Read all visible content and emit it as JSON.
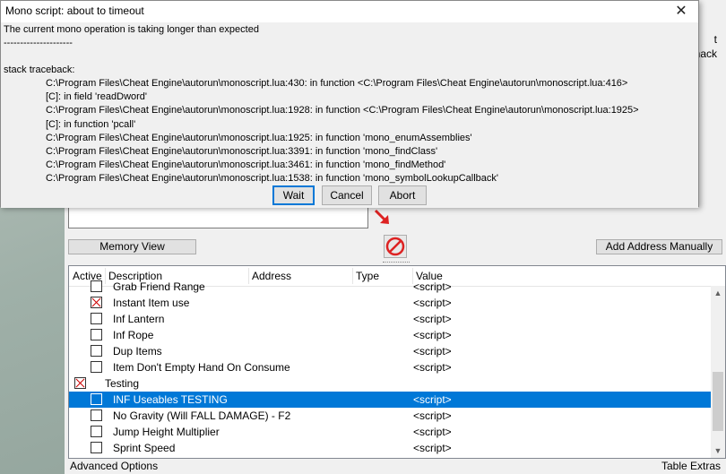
{
  "dialog": {
    "title": "Mono script: about to timeout",
    "close_glyph": "✕",
    "message": "The current mono operation is taking longer than expected",
    "separator": "---------------------",
    "traceback_header": "stack traceback:",
    "traceback": [
      "C:\\Program Files\\Cheat Engine\\autorun\\monoscript.lua:430: in function <C:\\Program Files\\Cheat Engine\\autorun\\monoscript.lua:416>",
      "[C]: in field 'readDword'",
      "C:\\Program Files\\Cheat Engine\\autorun\\monoscript.lua:1928: in function <C:\\Program Files\\Cheat Engine\\autorun\\monoscript.lua:1925>",
      "[C]: in function 'pcall'",
      "C:\\Program Files\\Cheat Engine\\autorun\\monoscript.lua:1925: in function 'mono_enumAssemblies'",
      "C:\\Program Files\\Cheat Engine\\autorun\\monoscript.lua:3391: in function 'mono_findClass'",
      "C:\\Program Files\\Cheat Engine\\autorun\\monoscript.lua:3461: in function 'mono_findMethod'",
      "C:\\Program Files\\Cheat Engine\\autorun\\monoscript.lua:1538: in function 'mono_symbolLookupCallback'"
    ],
    "buttons": {
      "wait": "Wait",
      "cancel": "Cancel",
      "abort": "Abort"
    }
  },
  "main": {
    "right_text": [
      "t",
      "hack"
    ],
    "memory_view_button": "Memory View",
    "add_address_button": "Add Address Manually",
    "arrow_icon": "red-arrow-icon",
    "stop_icon": "no-entry-icon"
  },
  "list": {
    "columns": [
      "Active",
      "Description",
      "Address",
      "Type",
      "Value"
    ],
    "rows": [
      {
        "desc": "Grab Friend Range",
        "value": "<script>",
        "checked": false,
        "indent": 1
      },
      {
        "desc": "Instant Item use",
        "value": "<script>",
        "checked": true,
        "indent": 1
      },
      {
        "desc": "Inf Lantern",
        "value": "<script>",
        "checked": false,
        "indent": 1
      },
      {
        "desc": "Inf Rope",
        "value": "<script>",
        "checked": false,
        "indent": 1
      },
      {
        "desc": "Dup Items",
        "value": "<script>",
        "checked": false,
        "indent": 1
      },
      {
        "desc": "Item Don't Empty Hand On Consume",
        "value": "<script>",
        "checked": false,
        "indent": 1
      },
      {
        "desc": "Testing",
        "value": "",
        "checked": true,
        "indent": 0
      },
      {
        "desc": "INF Useables TESTING",
        "value": "<script>",
        "checked": false,
        "indent": 1,
        "selected": true
      },
      {
        "desc": "No Gravity (Will FALL DAMAGE) - F2",
        "value": "<script>",
        "checked": false,
        "indent": 1
      },
      {
        "desc": "Jump Height Multiplier",
        "value": "<script>",
        "checked": false,
        "indent": 1
      },
      {
        "desc": "Sprint Speed",
        "value": "<script>",
        "checked": false,
        "indent": 1
      }
    ]
  },
  "footer": {
    "left": "Advanced Options",
    "right": "Table Extras"
  },
  "colors": {
    "selection": "#0078d7",
    "check_x": "#cc0000",
    "default_button_border": "#0078d7"
  }
}
